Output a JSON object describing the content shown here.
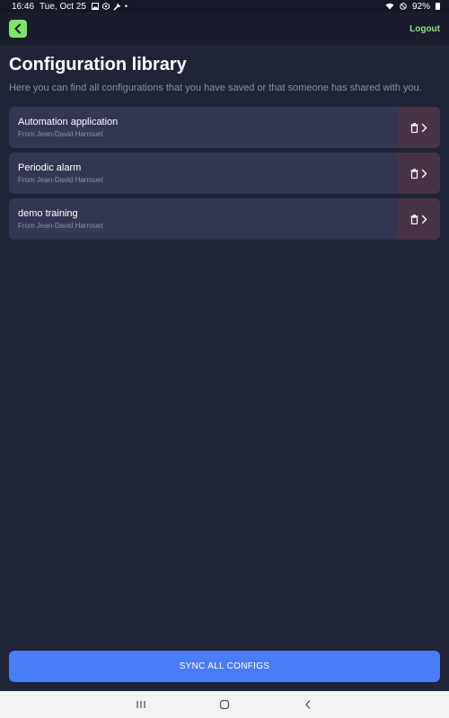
{
  "status_bar": {
    "time": "16:46",
    "date": "Tue, Oct 25",
    "dot": "•",
    "battery": "92%",
    "icons": [
      "image-icon",
      "vpn-icon",
      "wrench-icon",
      "wifi-icon",
      "do-not-disturb-icon",
      "battery-icon"
    ]
  },
  "app_bar": {
    "logout_label": "Logout"
  },
  "page": {
    "title": "Configuration library",
    "subtitle": "Here you can find all configurations that you have saved or that someone has shared with you."
  },
  "configs": [
    {
      "name": "Automation application",
      "from": "From Jean-David Harrouet"
    },
    {
      "name": "Periodic alarm",
      "from": "From Jean-David Harrouet"
    },
    {
      "name": "demo training",
      "from": "From Jean-David Harrouet"
    }
  ],
  "sync_label": "SYNC ALL CONFIGS",
  "colors": {
    "background": "#202438",
    "accent_green": "#7fe36a",
    "primary_blue": "#4a7cf7",
    "card": "#333753",
    "delete_area": "#4a3346"
  }
}
